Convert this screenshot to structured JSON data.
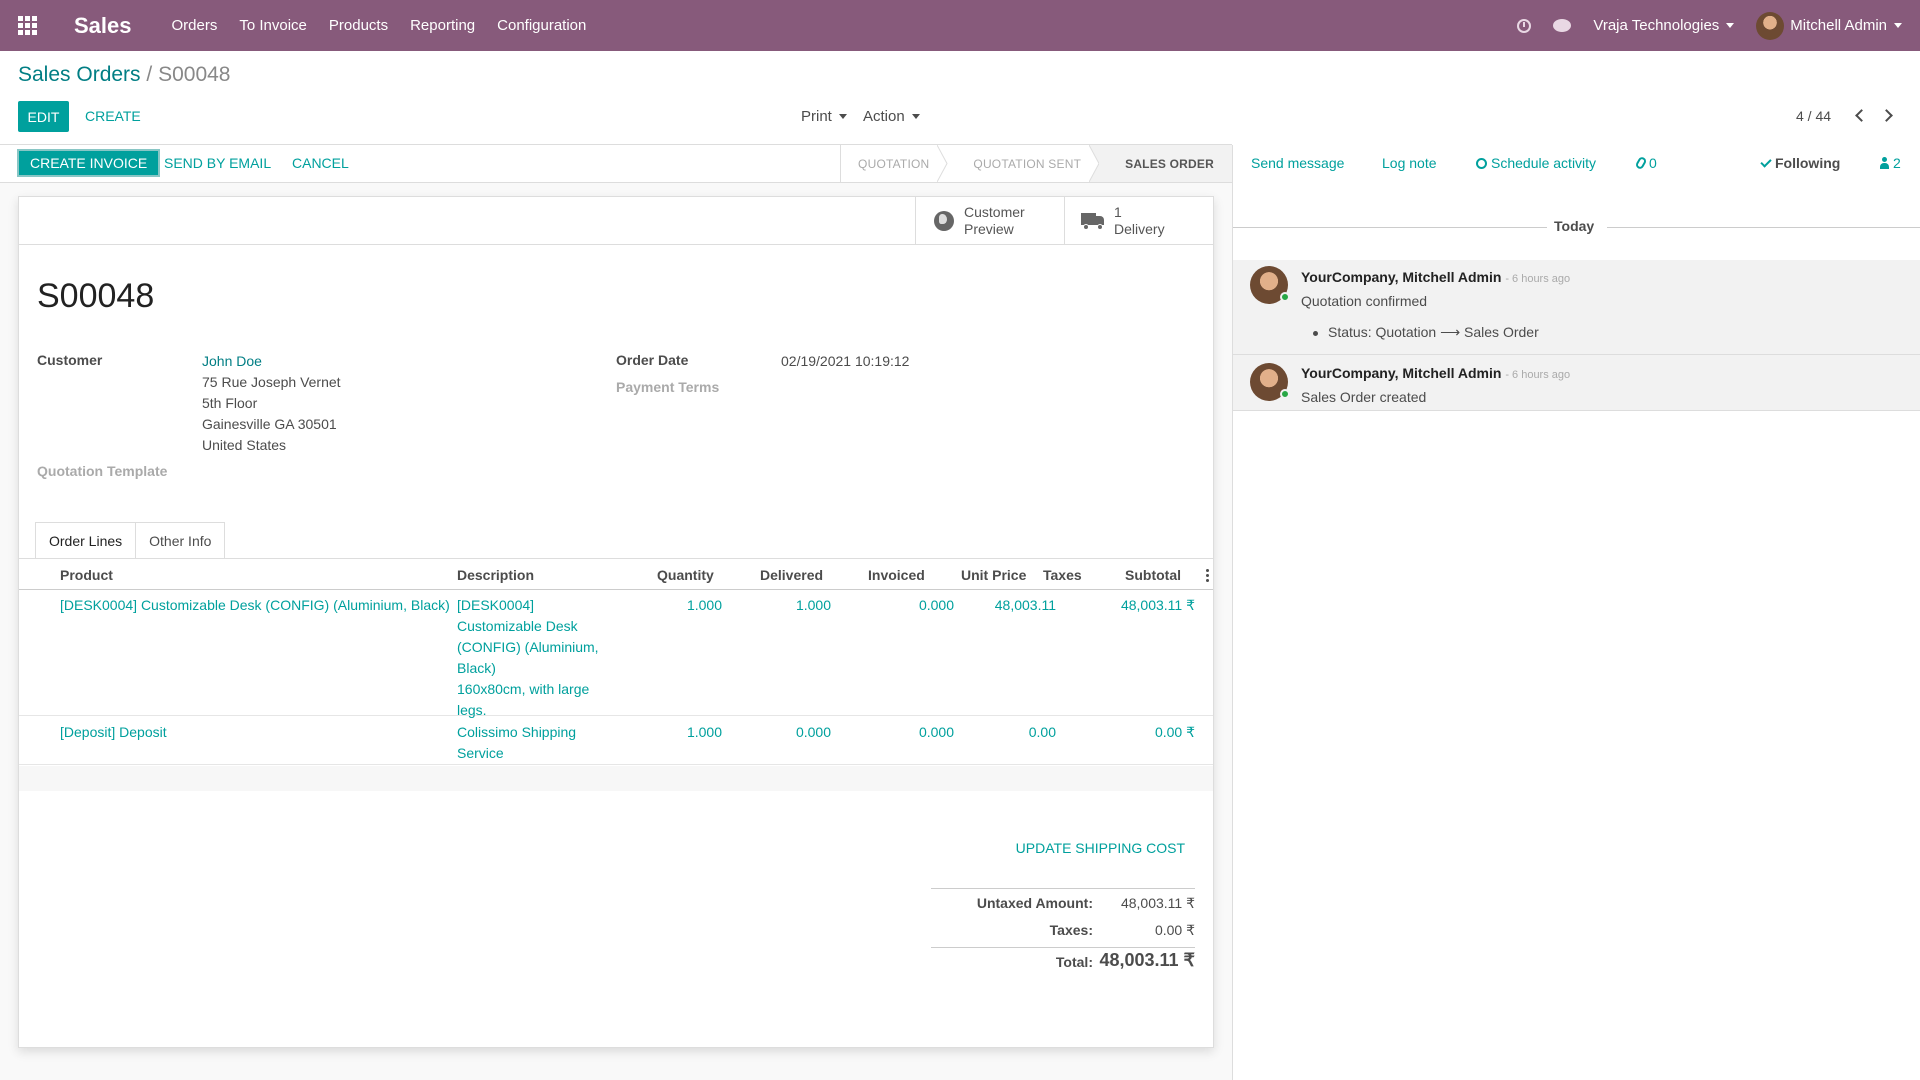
{
  "navbar": {
    "app_name": "Sales",
    "menu": [
      "Orders",
      "To Invoice",
      "Products",
      "Reporting",
      "Configuration"
    ],
    "company": "Vraja Technologies",
    "user": "Mitchell Admin",
    "brand_color": "#875a7b"
  },
  "control_panel": {
    "breadcrumb_parent": "Sales Orders",
    "breadcrumb_sep": "/",
    "breadcrumb_current": "S00048",
    "edit_label": "EDIT",
    "create_label": "CREATE",
    "print_label": "Print",
    "action_label": "Action",
    "pager": "4 / 44"
  },
  "statusbar": {
    "create_invoice": "CREATE INVOICE",
    "send_by_email": "SEND BY EMAIL",
    "cancel": "CANCEL",
    "stages": [
      "QUOTATION",
      "QUOTATION SENT",
      "SALES ORDER"
    ],
    "active_stage": "SALES ORDER"
  },
  "smart_buttons": {
    "preview_line1": "Customer",
    "preview_line2": "Preview",
    "delivery_count": "1",
    "delivery_label": "Delivery"
  },
  "form": {
    "name": "S00048",
    "customer_label": "Customer",
    "customer_name": "John Doe",
    "address": [
      "75 Rue Joseph Vernet",
      "5th Floor",
      "Gainesville GA 30501",
      "United States"
    ],
    "quotation_template_label": "Quotation Template",
    "order_date_label": "Order Date",
    "order_date": "02/19/2021 10:19:12",
    "payment_terms_label": "Payment Terms"
  },
  "tabs": [
    "Order Lines",
    "Other Info"
  ],
  "order_lines": {
    "columns": [
      "Product",
      "Description",
      "Quantity",
      "Delivered",
      "Invoiced",
      "Unit Price",
      "Taxes",
      "Subtotal"
    ],
    "rows": [
      {
        "product": "[DESK0004] Customizable Desk (CONFIG) (Aluminium, Black)",
        "description": [
          "[DESK0004]",
          "Customizable Desk",
          "(CONFIG) (Aluminium,",
          "Black)",
          "160x80cm, with large",
          "legs."
        ],
        "quantity": "1.000",
        "delivered": "1.000",
        "invoiced": "0.000",
        "unit_price": "48,003.11",
        "taxes": "",
        "subtotal": "48,003.11 ₹"
      },
      {
        "product": "[Deposit] Deposit",
        "description": [
          "Colissimo Shipping",
          "Service"
        ],
        "quantity": "1.000",
        "delivered": "0.000",
        "invoiced": "0.000",
        "unit_price": "0.00",
        "taxes": "",
        "subtotal": "0.00 ₹"
      }
    ]
  },
  "update_shipping_label": "UPDATE SHIPPING COST",
  "totals": {
    "untaxed_label": "Untaxed Amount:",
    "untaxed_value": "48,003.11 ₹",
    "taxes_label": "Taxes:",
    "taxes_value": "0.00 ₹",
    "total_label": "Total:",
    "total_value": "48,003.11 ₹"
  },
  "chatter": {
    "send_message": "Send message",
    "log_note": "Log note",
    "schedule_activity": "Schedule activity",
    "attachments": "0",
    "following": "Following",
    "followers": "2",
    "date_separator": "Today",
    "messages": [
      {
        "author": "YourCompany, Mitchell Admin",
        "time": "- 6 hours ago",
        "body": "Quotation confirmed",
        "tracking": "Status: Quotation ⟶ Sales Order"
      },
      {
        "author": "YourCompany, Mitchell Admin",
        "time": "- 6 hours ago",
        "body": "Sales Order created"
      }
    ]
  }
}
